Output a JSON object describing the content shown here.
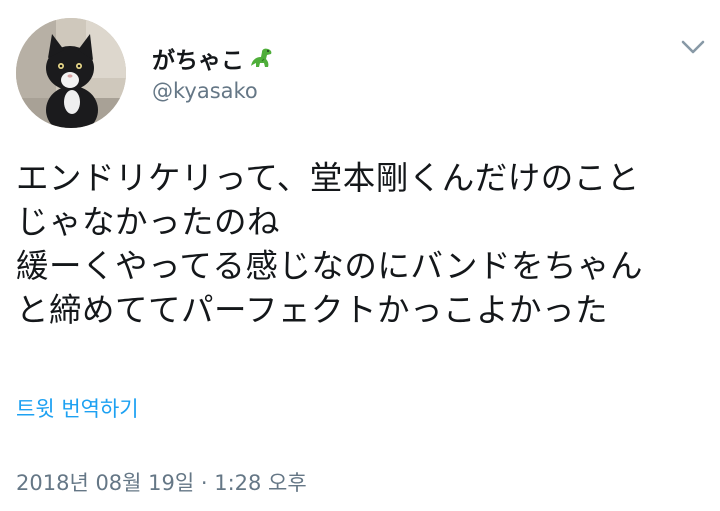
{
  "user": {
    "display_name": "がちゃこ",
    "handle": "@kyasako",
    "emoji_icon": "dinosaur-icon",
    "avatar_icon": "black-white-cat-photo"
  },
  "menu": {
    "icon": "chevron-down-icon"
  },
  "tweet": {
    "lines": [
      "エンドリケリって、堂本剛くんだけのこと",
      "じゃなかったのね",
      "緩ーくやってる感じなのにバンドをちゃん",
      "と締めててパーフェクトかっこよかった"
    ],
    "translate_label": "트윗 번역하기",
    "timestamp": "2018년 08월 19일 · 1:28 오후"
  },
  "colors": {
    "text": "#14171a",
    "secondary": "#657786",
    "link": "#1da1f2",
    "chevron": "#8899a6"
  }
}
